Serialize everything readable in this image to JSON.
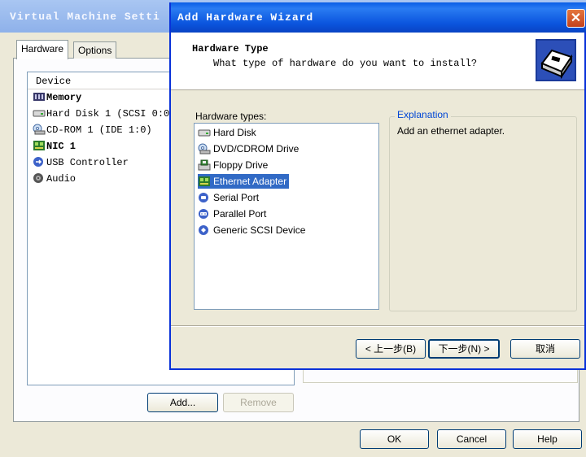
{
  "background_window": {
    "title": "Virtual Machine Setti",
    "tabs": [
      "Hardware",
      "Options"
    ],
    "device_header": "Device",
    "devices": [
      {
        "label": "Memory",
        "icon": "memory-icon"
      },
      {
        "label": "Hard Disk 1 (SCSI 0:0",
        "icon": "hard-disk-icon"
      },
      {
        "label": "CD-ROM 1 (IDE 1:0)",
        "icon": "cdrom-icon"
      },
      {
        "label": "NIC 1",
        "icon": "network-icon"
      },
      {
        "label": "USB Controller",
        "icon": "usb-icon"
      },
      {
        "label": "Audio",
        "icon": "audio-icon"
      }
    ],
    "add_label": "Add...",
    "remove_label": "Remove",
    "ok_label": "OK",
    "cancel_label": "Cancel",
    "help_label": "Help"
  },
  "wizard": {
    "title": "Add Hardware Wizard",
    "header_title": "Hardware Type",
    "header_subtitle": "What type of hardware do you want to install?",
    "list_label": "Hardware types:",
    "hardware_types": [
      {
        "label": "Hard Disk",
        "icon": "hard-disk-icon"
      },
      {
        "label": "DVD/CDROM Drive",
        "icon": "cdrom-icon"
      },
      {
        "label": "Floppy Drive",
        "icon": "floppy-icon"
      },
      {
        "label": "Ethernet Adapter",
        "icon": "network-icon",
        "selected": true
      },
      {
        "label": "Serial Port",
        "icon": "serial-port-icon"
      },
      {
        "label": "Parallel Port",
        "icon": "parallel-port-icon"
      },
      {
        "label": "Generic SCSI Device",
        "icon": "scsi-icon"
      }
    ],
    "explanation_title": "Explanation",
    "explanation_text": "Add an ethernet adapter.",
    "back_label": "< 上一步(B)",
    "next_label": "下一步(N) >",
    "cancel_label": "取消"
  },
  "colors": {
    "title_active": "#0a5ee6",
    "title_inactive": "#8eb1ea",
    "selection": "#316ac5",
    "explanation_title": "#0046d5"
  }
}
